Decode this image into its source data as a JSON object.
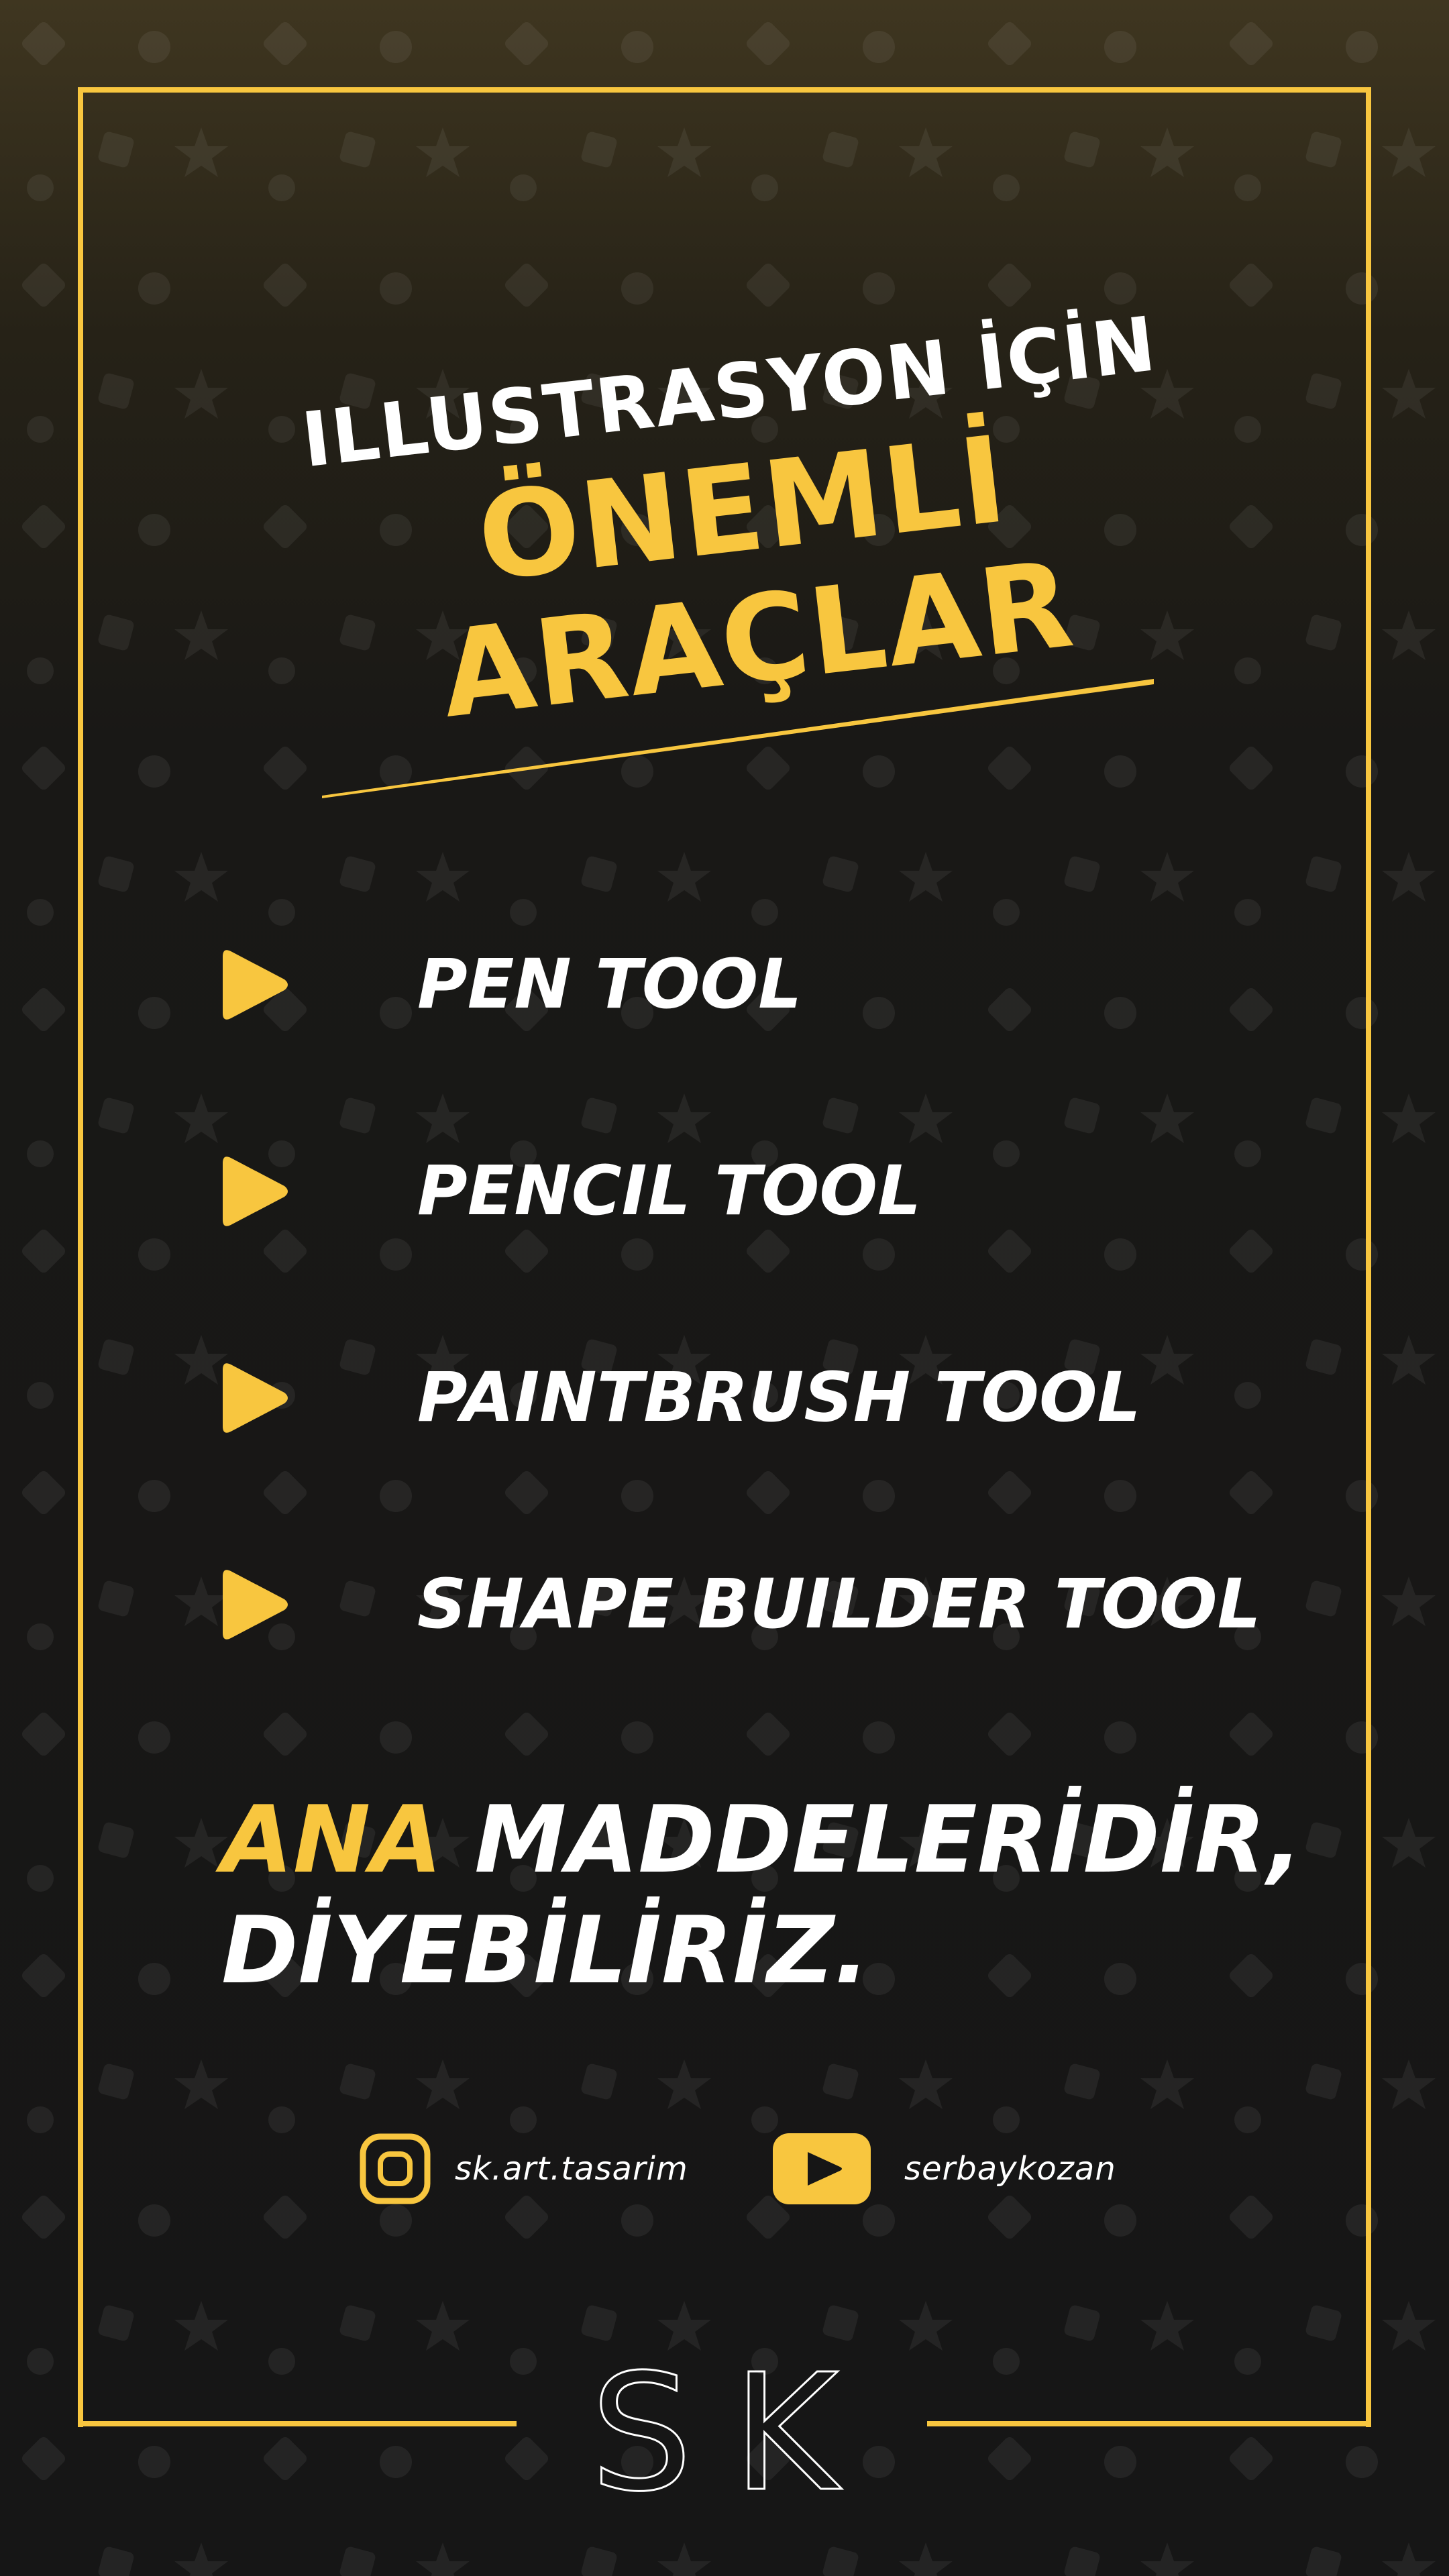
{
  "heading": {
    "line1": "ILLUSTRASYON İÇİN",
    "line2": "ÖNEMLİ ARAÇLAR"
  },
  "tools": [
    {
      "label": "PEN TOOL",
      "icon": "play-triangle-icon"
    },
    {
      "label": "PENCIL TOOL",
      "icon": "play-triangle-icon"
    },
    {
      "label": "PAINTBRUSH TOOL",
      "icon": "play-triangle-icon"
    },
    {
      "label": "SHAPE BUILDER TOOL",
      "icon": "play-triangle-icon"
    }
  ],
  "closing": {
    "accent": "ANA",
    "rest": "MADDELERİDİR,",
    "line2": "DİYEBİLİRİZ."
  },
  "social": {
    "instagram": {
      "icon": "instagram-icon",
      "handle": "sk.art.tasarim"
    },
    "youtube": {
      "icon": "youtube-icon",
      "handle": "serbaykozan"
    }
  },
  "logo": {
    "text": "SK"
  },
  "colors": {
    "accent": "#f8c63f",
    "text": "#ffffff",
    "background": "#161616"
  }
}
